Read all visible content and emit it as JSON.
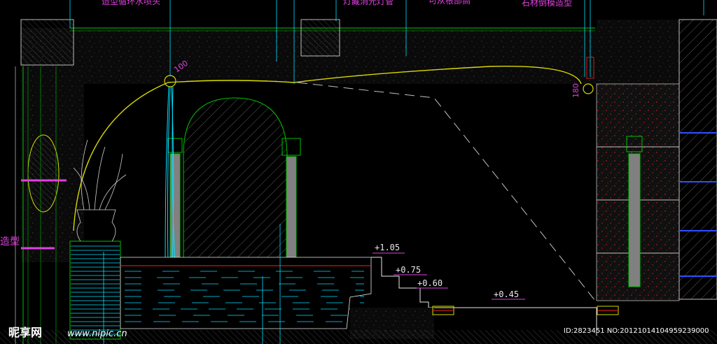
{
  "labels": {
    "nozzle": "造型循环水喷头",
    "lamp_tube": "灯藏消光灯管",
    "center_top": "可从根部高",
    "moulding": "石材倒模造型",
    "side_left": "造型",
    "dim_100": "100",
    "dim_180": "180"
  },
  "elevations": [
    "+1.05",
    "+0.75",
    "+0.60",
    "+0.45"
  ],
  "watermark": {
    "logo": "昵享网",
    "url": "www.nipic.cn",
    "id_text": "ID:2823451 NO:20121014104959239000"
  },
  "colors": {
    "background": "#000000",
    "green": "#00c000",
    "cyan": "#00e0ff",
    "magenta": "#e040e0",
    "yellow": "#d8d800",
    "red": "#ff2020",
    "white": "#e8e8e8"
  }
}
